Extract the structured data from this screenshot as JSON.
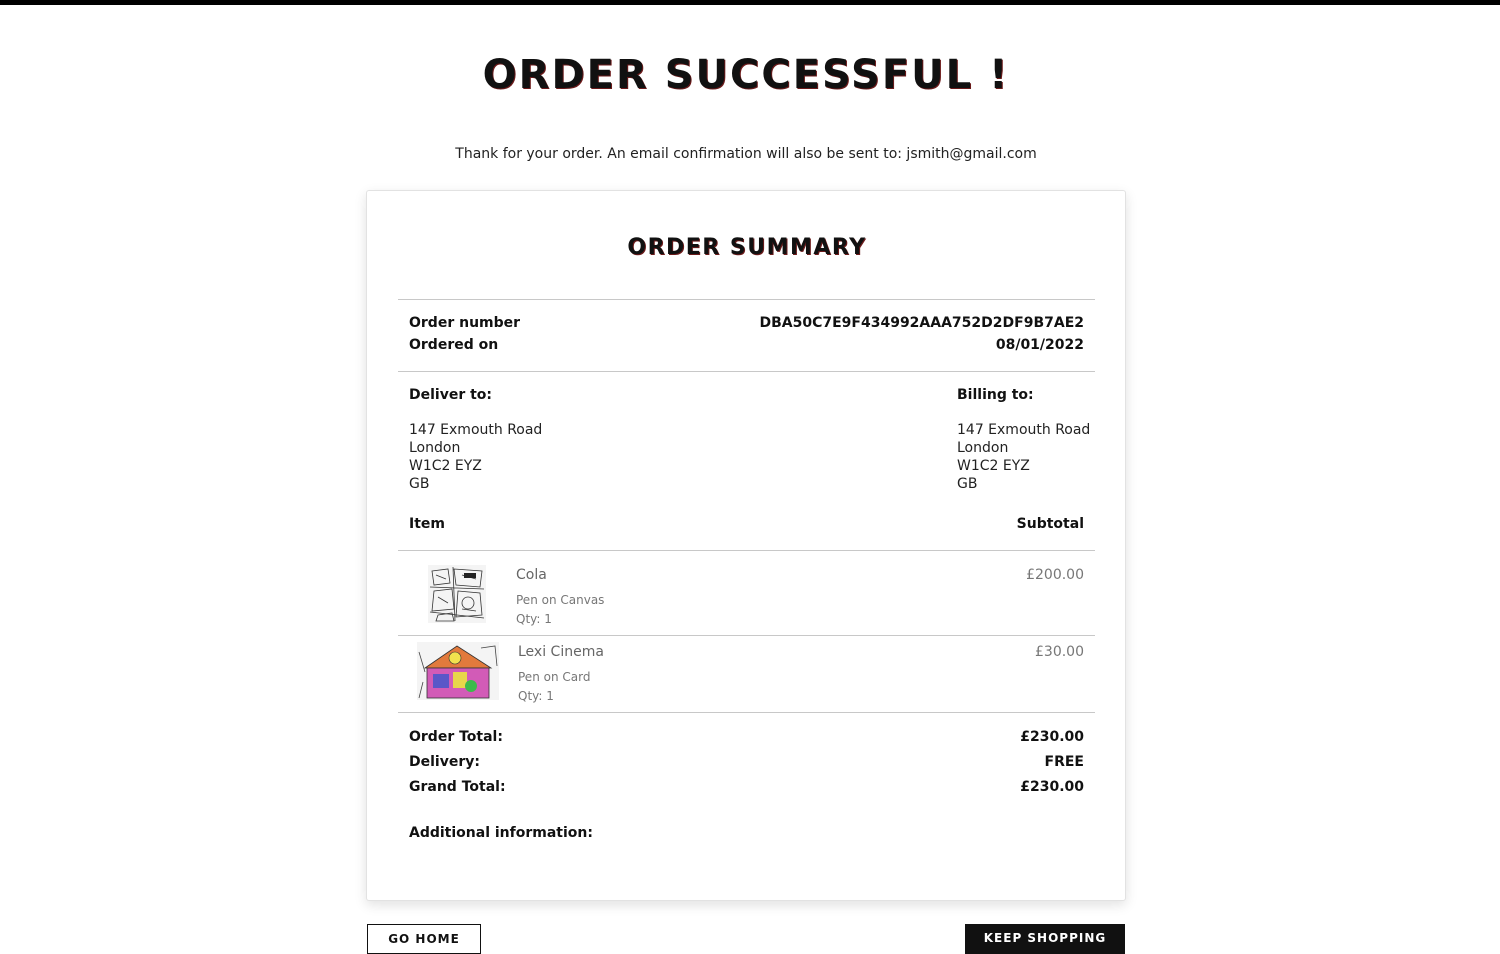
{
  "page": {
    "title": "ORDER SUCCESSFUL !",
    "thanks_message": "Thank for your order. An email confirmation will also be sent to: jsmith@gmail.com"
  },
  "summary": {
    "title": "ORDER SUMMARY",
    "order_number_label": "Order number",
    "order_number": "DBA50C7E9F434992AAA752D2DF9B7AE2",
    "ordered_on_label": "Ordered on",
    "ordered_on": "08/01/2022",
    "deliver_to": {
      "heading": "Deliver to:",
      "line1": "147 Exmouth Road",
      "line2": "London",
      "line3": "W1C2 EYZ",
      "line4": "GB"
    },
    "billing_to": {
      "heading": "Billing to:",
      "line1": "147 Exmouth Road",
      "line2": "London",
      "line3": "W1C2 EYZ",
      "line4": "GB"
    },
    "item_header": "Item",
    "subtotal_header": "Subtotal",
    "items": [
      {
        "name": "Cola",
        "medium": "Pen on Canvas",
        "qty": "Qty: 1",
        "price": "£200.00"
      },
      {
        "name": "Lexi Cinema",
        "medium": "Pen on Card",
        "qty": "Qty: 1",
        "price": "£30.00"
      }
    ],
    "order_total_label": "Order Total:",
    "order_total": "£230.00",
    "delivery_label": "Delivery:",
    "delivery": "FREE",
    "grand_total_label": "Grand Total:",
    "grand_total": "£230.00",
    "additional_info_label": "Additional information:"
  },
  "actions": {
    "home_label": "GO HOME",
    "shop_label": "KEEP SHOPPING"
  }
}
